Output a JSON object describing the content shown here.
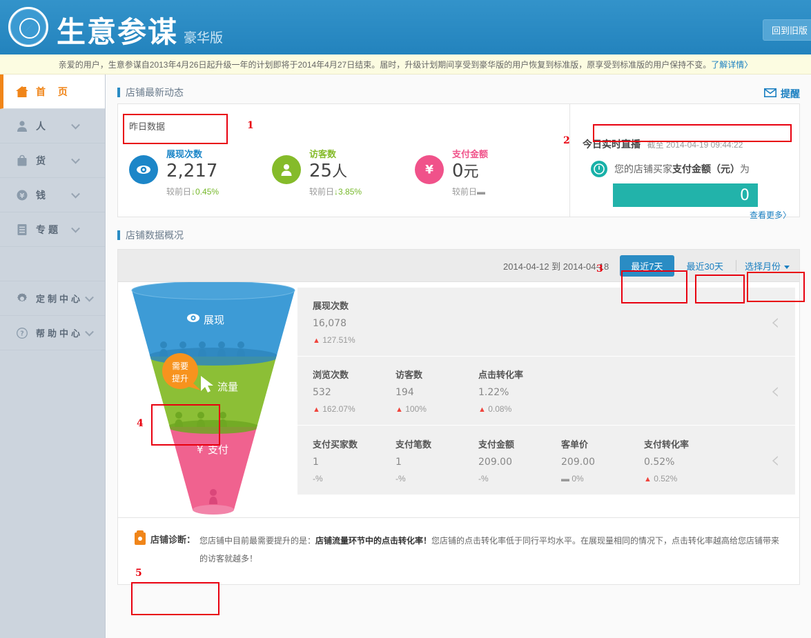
{
  "header": {
    "logo_title": "生意参谋",
    "logo_subtitle": "豪华版",
    "old_version_button": "回到旧版"
  },
  "notice": {
    "text": "亲爱的用户，生意参谋自2013年4月26日起升级一年的计划即将于2014年4月27日结束。届时，升级计划期间享受到豪华版的用户恢复到标准版，原享受到标准版的用户保持不变。",
    "link": "了解详情〉"
  },
  "sidebar": {
    "items": [
      {
        "label": "首 页",
        "icon": "home-icon",
        "active": true
      },
      {
        "label": "人",
        "icon": "person-icon"
      },
      {
        "label": "货",
        "icon": "bag-icon"
      },
      {
        "label": "钱",
        "icon": "yen-circle-icon"
      },
      {
        "label": "专题",
        "icon": "list-icon"
      },
      {
        "label": "定制中心",
        "icon": "gear-icon"
      },
      {
        "label": "帮助中心",
        "icon": "question-circle-icon"
      }
    ]
  },
  "section1": {
    "title": "店铺最新动态",
    "remind_label": "提醒",
    "yesterday_label": "昨日数据",
    "stats": [
      {
        "name": "展现次数",
        "value": "2,217",
        "unit": "",
        "compare_label": "较前日",
        "change": "0.45%",
        "direction": "down",
        "color": "#1c86c8",
        "icon": "eye-icon"
      },
      {
        "name": "访客数",
        "value": "25",
        "unit": "人",
        "compare_label": "较前日",
        "change": "3.85%",
        "direction": "down",
        "color": "#85bb2a",
        "icon": "person-icon"
      },
      {
        "name": "支付金额",
        "value": "0",
        "unit": "元",
        "compare_label": "较前日",
        "change": "",
        "direction": "flat",
        "color": "#f0528a",
        "icon": "yen-icon"
      }
    ],
    "live": {
      "title": "今日实时直播",
      "timestamp": "截至 2014-04-19 09:44:22",
      "desc_prefix": "您的店铺买家",
      "desc_bold": "支付金额（元）",
      "desc_suffix": "为",
      "value": "0",
      "see_more": "查看更多〉",
      "bar_color": "#22b3aa"
    }
  },
  "section2": {
    "title": "店铺数据概况",
    "date_range": "2014-04-12 到 2014-04-18",
    "btn_7days": "最近7天",
    "btn_30days": "最近30天",
    "btn_month": "选择月份",
    "funnel": {
      "stages": [
        {
          "label": "展现",
          "icon": "eye-icon",
          "color": "#3d9bd6"
        },
        {
          "label": "流量",
          "icon": "cursor-icon",
          "color": "#8cbf36"
        },
        {
          "label": "支付",
          "icon": "yen-icon",
          "color": "#f0628f"
        }
      ],
      "bubble": {
        "line1": "需要",
        "line2": "提升",
        "color": "#f7931e"
      }
    },
    "rows": [
      {
        "metrics": [
          {
            "name": "展现次数",
            "value": "16,078",
            "change": "127.51%",
            "direction": "up"
          }
        ]
      },
      {
        "metrics": [
          {
            "name": "浏览次数",
            "value": "532",
            "change": "162.07%",
            "direction": "up"
          },
          {
            "name": "访客数",
            "value": "194",
            "change": "100%",
            "direction": "up"
          },
          {
            "name": "点击转化率",
            "value": "1.22%",
            "change": "0.08%",
            "direction": "up"
          }
        ]
      },
      {
        "metrics": [
          {
            "name": "支付买家数",
            "value": "1",
            "change": "-%",
            "direction": "none"
          },
          {
            "name": "支付笔数",
            "value": "1",
            "change": "-%",
            "direction": "none"
          },
          {
            "name": "支付金额",
            "value": "209.00",
            "change": "-%",
            "direction": "none"
          },
          {
            "name": "客单价",
            "value": "209.00",
            "change": "0%",
            "direction": "flat"
          },
          {
            "name": "支付转化率",
            "value": "0.52%",
            "change": "0.52%",
            "direction": "up"
          }
        ]
      }
    ]
  },
  "diagnosis": {
    "title": "店铺诊断：",
    "text_part1": "您店铺中目前最需要提升的是：",
    "text_bold": "店铺流量环节中的点击转化率！",
    "text_part2": "您店铺的点击转化率低于同行平均水平。在展现量相同的情况下，点击转化率越高给您店铺带来的访客就越多！"
  },
  "annotations": {
    "numbers": [
      "1",
      "2",
      "3",
      "4",
      "5"
    ],
    "color": "#e8000f"
  }
}
